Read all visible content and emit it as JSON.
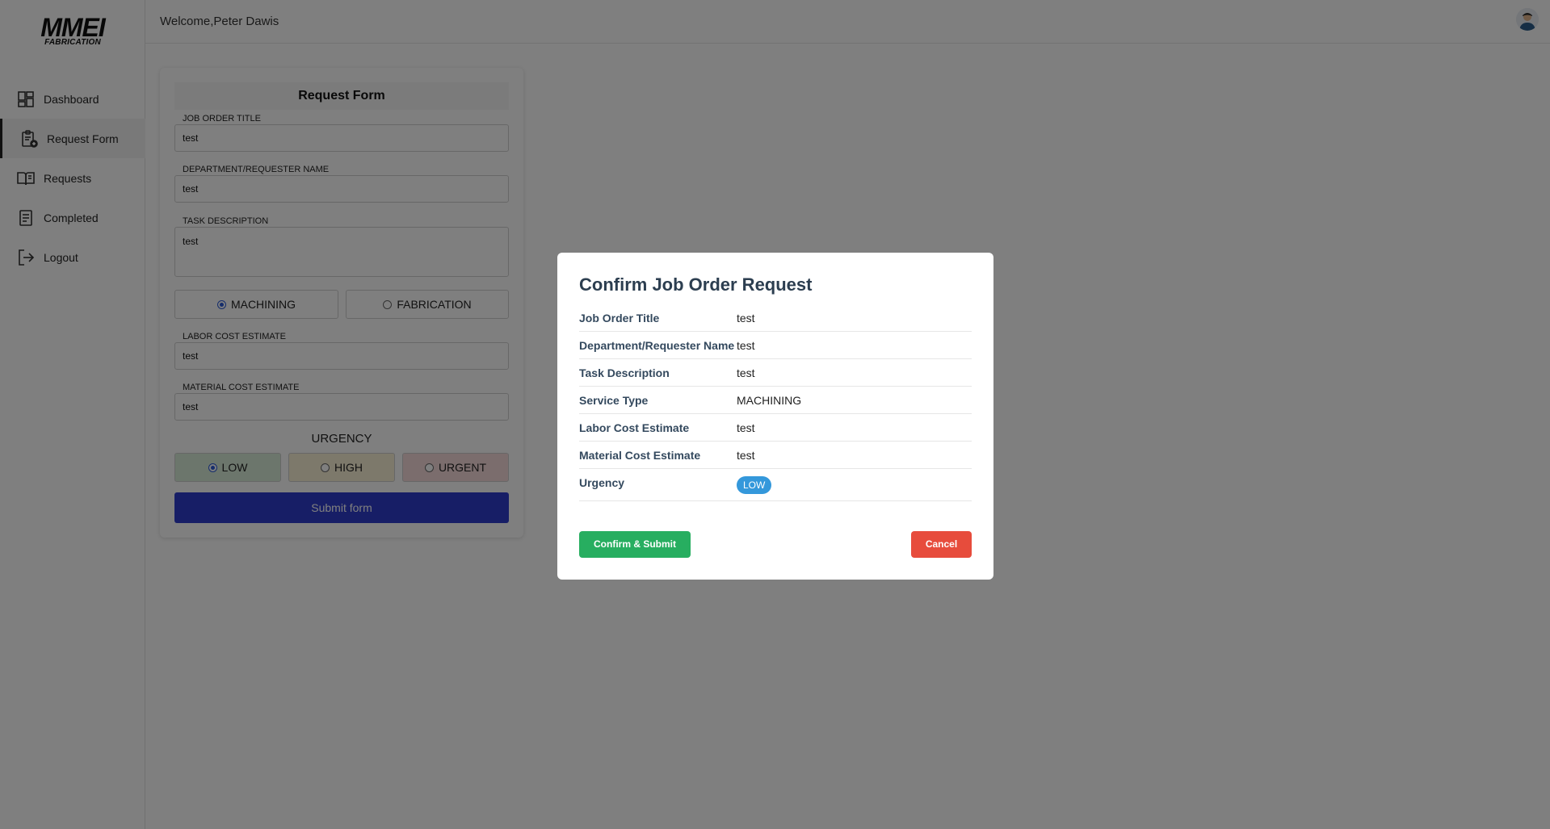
{
  "brand": {
    "name": "MMEI",
    "sub": "FABRICATION"
  },
  "sidebar": {
    "items": [
      {
        "label": "Dashboard",
        "icon": "dashboard-icon"
      },
      {
        "label": "Request Form",
        "icon": "clipboard-add-icon",
        "active": true
      },
      {
        "label": "Requests",
        "icon": "book-open-icon"
      },
      {
        "label": "Completed",
        "icon": "document-icon"
      },
      {
        "label": "Logout",
        "icon": "logout-icon"
      }
    ]
  },
  "header": {
    "welcome": "Welcome,Peter Dawis",
    "avatar_icon": "user-avatar-icon"
  },
  "form": {
    "title": "Request Form",
    "job_order_title_label": "JOB ORDER TITLE",
    "job_order_title_value": "test",
    "department_label": "DEPARTMENT/REQUESTER NAME",
    "department_value": "test",
    "task_description_label": "TASK DESCRIPTION",
    "task_description_value": "test",
    "service_types": [
      {
        "label": "MACHINING",
        "selected": true
      },
      {
        "label": "FABRICATION",
        "selected": false
      }
    ],
    "labor_cost_label": "LABOR COST ESTIMATE",
    "labor_cost_value": "test",
    "material_cost_label": "MATERIAL COST ESTIMATE",
    "material_cost_value": "test",
    "urgency_title": "URGENCY",
    "urgency_options": [
      {
        "label": "LOW",
        "selected": true,
        "color": "#d8ecd8"
      },
      {
        "label": "HIGH",
        "selected": false,
        "color": "#fbf3d6"
      },
      {
        "label": "URGENT",
        "selected": false,
        "color": "#f7dada"
      }
    ],
    "submit_label": "Submit form",
    "submit_color": "#2f3dcc"
  },
  "modal": {
    "title": "Confirm Job Order Request",
    "rows": [
      {
        "key": "Job Order Title",
        "value": "test"
      },
      {
        "key": "Department/Requester Name",
        "value": "test"
      },
      {
        "key": "Task Description",
        "value": "test"
      },
      {
        "key": "Service Type",
        "value": "MACHINING"
      },
      {
        "key": "Labor Cost Estimate",
        "value": "test"
      },
      {
        "key": "Material Cost Estimate",
        "value": "test"
      },
      {
        "key": "Urgency",
        "value": "LOW"
      }
    ],
    "confirm_label": "Confirm & Submit",
    "cancel_label": "Cancel",
    "confirm_color": "#27ae60",
    "cancel_color": "#e74c3c",
    "badge_color": "#3498db"
  }
}
